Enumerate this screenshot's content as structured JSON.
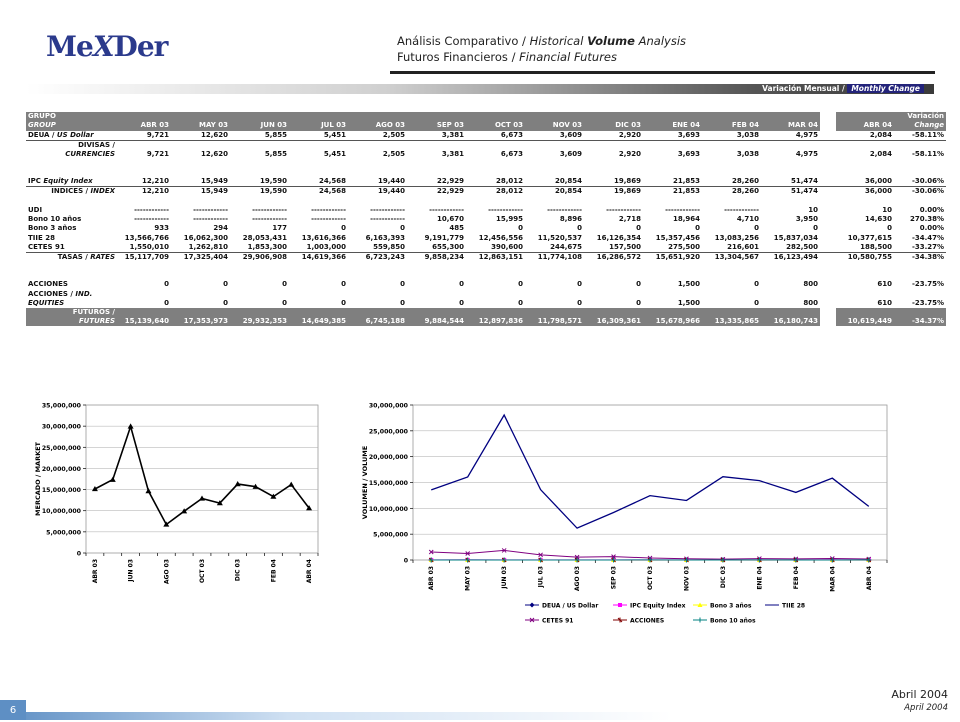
{
  "logo": {
    "pre": "Me",
    "x": "X",
    "post": "Der"
  },
  "header": {
    "line1_a": "Análisis Comparativo / ",
    "line1_b": "Historical ",
    "line1_c": "Volume",
    "line1_d": " Analysis",
    "line2_a": "Futuros Financieros / ",
    "line2_b": "Financial Futures"
  },
  "monthly_change": {
    "es": "Variación Mensual / ",
    "en": "Monthly Change"
  },
  "table": {
    "head1": {
      "group": "GRUPO",
      "var": "Variación"
    },
    "head2": {
      "group": "GROUP",
      "change": "Change"
    },
    "months": [
      "ABR 03",
      "MAY 03",
      "JUN 03",
      "JUL 03",
      "AGO 03",
      "SEP 03",
      "OCT 03",
      "NOV 03",
      "DIC 03",
      "ENE 04",
      "FEB 04",
      "MAR 04"
    ],
    "abr04": "ABR 04",
    "rows": [
      {
        "label": "DEUA / ",
        "label_i": "US Dollar",
        "v": [
          "9,721",
          "12,620",
          "5,855",
          "5,451",
          "2,505",
          "3,381",
          "6,673",
          "3,609",
          "2,920",
          "3,693",
          "3,038",
          "4,975"
        ],
        "a": "2,084",
        "c": "-58.11%"
      },
      {
        "label": "DIVISAS /",
        "label2": "CURRENCIES",
        "v": [
          "9,721",
          "12,620",
          "5,855",
          "5,451",
          "2,505",
          "3,381",
          "6,673",
          "3,609",
          "2,920",
          "3,693",
          "3,038",
          "4,975"
        ],
        "a": "2,084",
        "c": "-58.11%"
      },
      {
        "label": "IPC ",
        "label_i": "Equity Index",
        "v": [
          "12,210",
          "15,949",
          "19,590",
          "24,568",
          "19,440",
          "22,929",
          "28,012",
          "20,854",
          "19,869",
          "21,853",
          "28,260",
          "51,474"
        ],
        "a": "36,000",
        "c": "-30.06%"
      },
      {
        "label": "INDICES / ",
        "label_i": "INDEX",
        "v": [
          "12,210",
          "15,949",
          "19,590",
          "24,568",
          "19,440",
          "22,929",
          "28,012",
          "20,854",
          "19,869",
          "21,853",
          "28,260",
          "51,474"
        ],
        "a": "36,000",
        "c": "-30.06%"
      },
      {
        "label": "UDI",
        "v": [
          "------------",
          "------------",
          "------------",
          "------------",
          "------------",
          "------------",
          "------------",
          "------------",
          "------------",
          "------------",
          "------------",
          "10"
        ],
        "a": "10",
        "c": "0.00%"
      },
      {
        "label": "Bono 10 años",
        "v": [
          "------------",
          "------------",
          "------------",
          "------------",
          "------------",
          "10,670",
          "15,995",
          "8,896",
          "2,718",
          "18,964",
          "4,710",
          "3,950"
        ],
        "a": "14,630",
        "c": "270.38%"
      },
      {
        "label": "Bono 3 años",
        "v": [
          "933",
          "294",
          "177",
          "0",
          "0",
          "485",
          "0",
          "0",
          "0",
          "0",
          "0",
          "0"
        ],
        "a": "0",
        "c": "0.00%"
      },
      {
        "label": "TIIE 28",
        "v": [
          "13,566,766",
          "16,062,300",
          "28,053,431",
          "13,616,366",
          "6,163,393",
          "9,191,779",
          "12,456,556",
          "11,520,537",
          "16,126,354",
          "15,357,456",
          "13,083,256",
          "15,837,034"
        ],
        "a": "10,377,615",
        "c": "-34.47%"
      },
      {
        "label": "CETES 91",
        "v": [
          "1,550,010",
          "1,262,810",
          "1,853,300",
          "1,003,000",
          "559,850",
          "655,300",
          "390,600",
          "244,675",
          "157,500",
          "275,500",
          "216,601",
          "282,500"
        ],
        "a": "188,500",
        "c": "-33.27%"
      },
      {
        "label": "TASAS / ",
        "label_i": "RATES",
        "v": [
          "15,117,709",
          "17,325,404",
          "29,906,908",
          "14,619,366",
          "6,723,243",
          "9,858,234",
          "12,863,151",
          "11,774,108",
          "16,286,572",
          "15,651,920",
          "13,304,567",
          "16,123,494"
        ],
        "a": "10,580,755",
        "c": "-34.38%"
      },
      {
        "label": "ACCIONES",
        "v": [
          "0",
          "0",
          "0",
          "0",
          "0",
          "0",
          "0",
          "0",
          "0",
          "1,500",
          "0",
          "800"
        ],
        "a": "610",
        "c": "-23.75%"
      },
      {
        "label": "ACCIONES / ",
        "label_i": "IND.",
        "label2": "EQUITIES",
        "v": [
          "0",
          "0",
          "0",
          "0",
          "0",
          "0",
          "0",
          "0",
          "0",
          "1,500",
          "0",
          "800"
        ],
        "a": "610",
        "c": "-23.75%"
      },
      {
        "label": "FUTUROS /",
        "label2": "FUTURES",
        "v": [
          "15,139,640",
          "17,353,973",
          "29,932,353",
          "14,649,385",
          "6,745,188",
          "9,884,544",
          "12,897,836",
          "11,798,571",
          "16,309,361",
          "15,678,966",
          "13,335,865",
          "16,180,743"
        ],
        "a": "10,619,449",
        "c": "-34.37%"
      }
    ]
  },
  "chart_data": [
    {
      "type": "line",
      "ylabel": "MERCADO / MARKET",
      "categories": [
        "ABR 03",
        "MAY 03",
        "JUN 03",
        "JUL 03",
        "AGO 03",
        "SEP 03",
        "OCT 03",
        "NOV 03",
        "DIC 03",
        "ENE 04",
        "FEB 04",
        "MAR 04",
        "ABR 04"
      ],
      "tick_labels": [
        "ABR 03",
        "JUN 03",
        "AGO 03",
        "OCT 03",
        "DIC 03",
        "FEB 04",
        "ABR 04"
      ],
      "values": [
        15139640,
        17353973,
        29932353,
        14649385,
        6745188,
        9884544,
        12897836,
        11798571,
        16309361,
        15678966,
        13335865,
        16180743,
        10619449
      ],
      "ylim": [
        0,
        35000000
      ],
      "yticks": [
        "0",
        "5,000,000",
        "10,000,000",
        "15,000,000",
        "20,000,000",
        "25,000,000",
        "30,000,000",
        "35,000,000"
      ],
      "grid": true,
      "color": "#000000"
    },
    {
      "type": "line",
      "ylabel": "VOLUMEN / VOLUME",
      "categories": [
        "ABR 03",
        "MAY 03",
        "JUN 03",
        "JUL 03",
        "AGO 03",
        "SEP 03",
        "OCT 03",
        "NOV 03",
        "DIC 03",
        "ENE 04",
        "FEB 04",
        "MAR 04",
        "ABR 04"
      ],
      "ylim": [
        0,
        30000000
      ],
      "yticks": [
        "0",
        "5,000,000",
        "10,000,000",
        "15,000,000",
        "20,000,000",
        "25,000,000",
        "30,000,000"
      ],
      "grid": true,
      "legend_position": "bottom",
      "series": [
        {
          "name": "DEUA / US Dollar",
          "color": "#000080",
          "values": [
            9721,
            12620,
            5855,
            5451,
            2505,
            3381,
            6673,
            3609,
            2920,
            3693,
            3038,
            4975,
            2084
          ]
        },
        {
          "name": "IPC Equity Index",
          "color": "#ff00ff",
          "values": [
            12210,
            15949,
            19590,
            24568,
            19440,
            22929,
            28012,
            20854,
            19869,
            21853,
            28260,
            51474,
            36000
          ]
        },
        {
          "name": "Bono 3 años",
          "color": "#ffff00",
          "values": [
            933,
            294,
            177,
            0,
            0,
            485,
            0,
            0,
            0,
            0,
            0,
            0,
            0
          ]
        },
        {
          "name": "TIIE 28",
          "color": "#000080",
          "values": [
            13566766,
            16062300,
            28053431,
            13616366,
            6163393,
            9191779,
            12456556,
            11520537,
            16126354,
            15357456,
            13083256,
            15837034,
            10377615
          ]
        },
        {
          "name": "CETES 91",
          "color": "#800080",
          "values": [
            1550010,
            1262810,
            1853300,
            1003000,
            559850,
            655300,
            390600,
            244675,
            157500,
            275500,
            216601,
            282500,
            188500
          ]
        },
        {
          "name": "ACCIONES",
          "color": "#800000",
          "values": [
            0,
            0,
            0,
            0,
            0,
            0,
            0,
            0,
            0,
            1500,
            0,
            800,
            610
          ]
        },
        {
          "name": "Bono 10 años",
          "color": "#008080",
          "values": [
            0,
            0,
            0,
            0,
            0,
            10670,
            15995,
            8896,
            2718,
            18964,
            4710,
            3950,
            14630
          ]
        }
      ]
    }
  ],
  "footer": {
    "page": "6",
    "date_es": "Abril 2004",
    "date_en": "April 2004"
  }
}
